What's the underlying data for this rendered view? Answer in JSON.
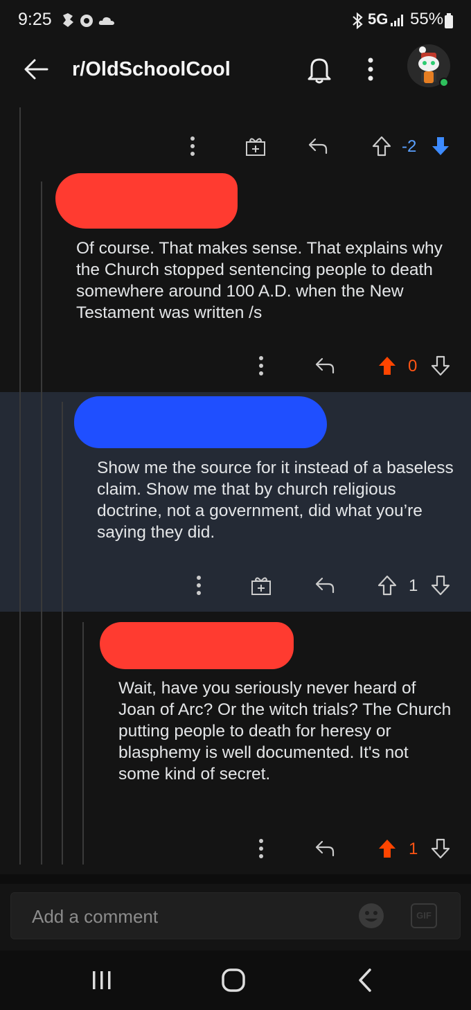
{
  "status_bar": {
    "time": "9:25",
    "network": "5G",
    "battery": "55%"
  },
  "header": {
    "title": "r/OldSchoolCool"
  },
  "comments": [
    {
      "score": "-2",
      "vote_state": "downvoted"
    },
    {
      "body": "Of course. That makes sense. That explains why the Church stopped sentencing people to death somewhere around 100 A.D. when the New Testament was written  /s",
      "score": "0",
      "vote_state": "upvoted",
      "redaction_color": "#ff3b30"
    },
    {
      "body": "Show me the source for it instead of a baseless claim. Show me that by church religious doctrine, not a government, did what you’re saying they did.",
      "score": "1",
      "vote_state": "none",
      "redaction_color": "#1f4fff"
    },
    {
      "body": "Wait, have you seriously never heard of Joan of Arc? Or the witch trials? The Church putting people to death for heresy or blasphemy is well documented. It's not some kind of secret.",
      "score": "1",
      "vote_state": "upvoted",
      "redaction_color": "#ff3b30"
    }
  ],
  "comment_input": {
    "placeholder": "Add a comment",
    "gif_label": "GIF"
  },
  "colors": {
    "upvote": "#ff4500",
    "downvote": "#3d8bff",
    "highlight_bg": "#242a35"
  }
}
